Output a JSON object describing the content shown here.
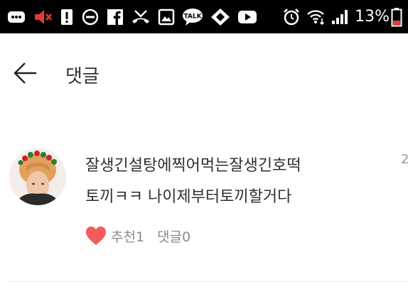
{
  "status_bar": {
    "battery_percent": "13%",
    "icons": [
      "messages-icon",
      "volume-muted-icon",
      "alert-icon",
      "do-not-disturb-icon",
      "facebook-icon",
      "missed-call-icon",
      "gallery-icon",
      "kakaotalk-icon",
      "tag-icon",
      "youtube-icon",
      "alarm-icon",
      "wifi-icon",
      "signal-icon",
      "battery-low-icon"
    ],
    "talk_badge": "TALK",
    "colors": {
      "background": "#000000",
      "muted_speaker": "#e53935",
      "battery_low": "#e53935"
    }
  },
  "header": {
    "back_icon": "arrow-left-icon",
    "title": "댓글"
  },
  "comment": {
    "text_line1": "잘생긴설탕에찍어먹는잘생긴호떡",
    "text_line2": "토끼ㅋㅋ 나이제부터토끼할거다",
    "timestamp": "2",
    "recommend_label": "추천1",
    "reply_label": "댓글0",
    "heart_color": "#f25c5c"
  }
}
